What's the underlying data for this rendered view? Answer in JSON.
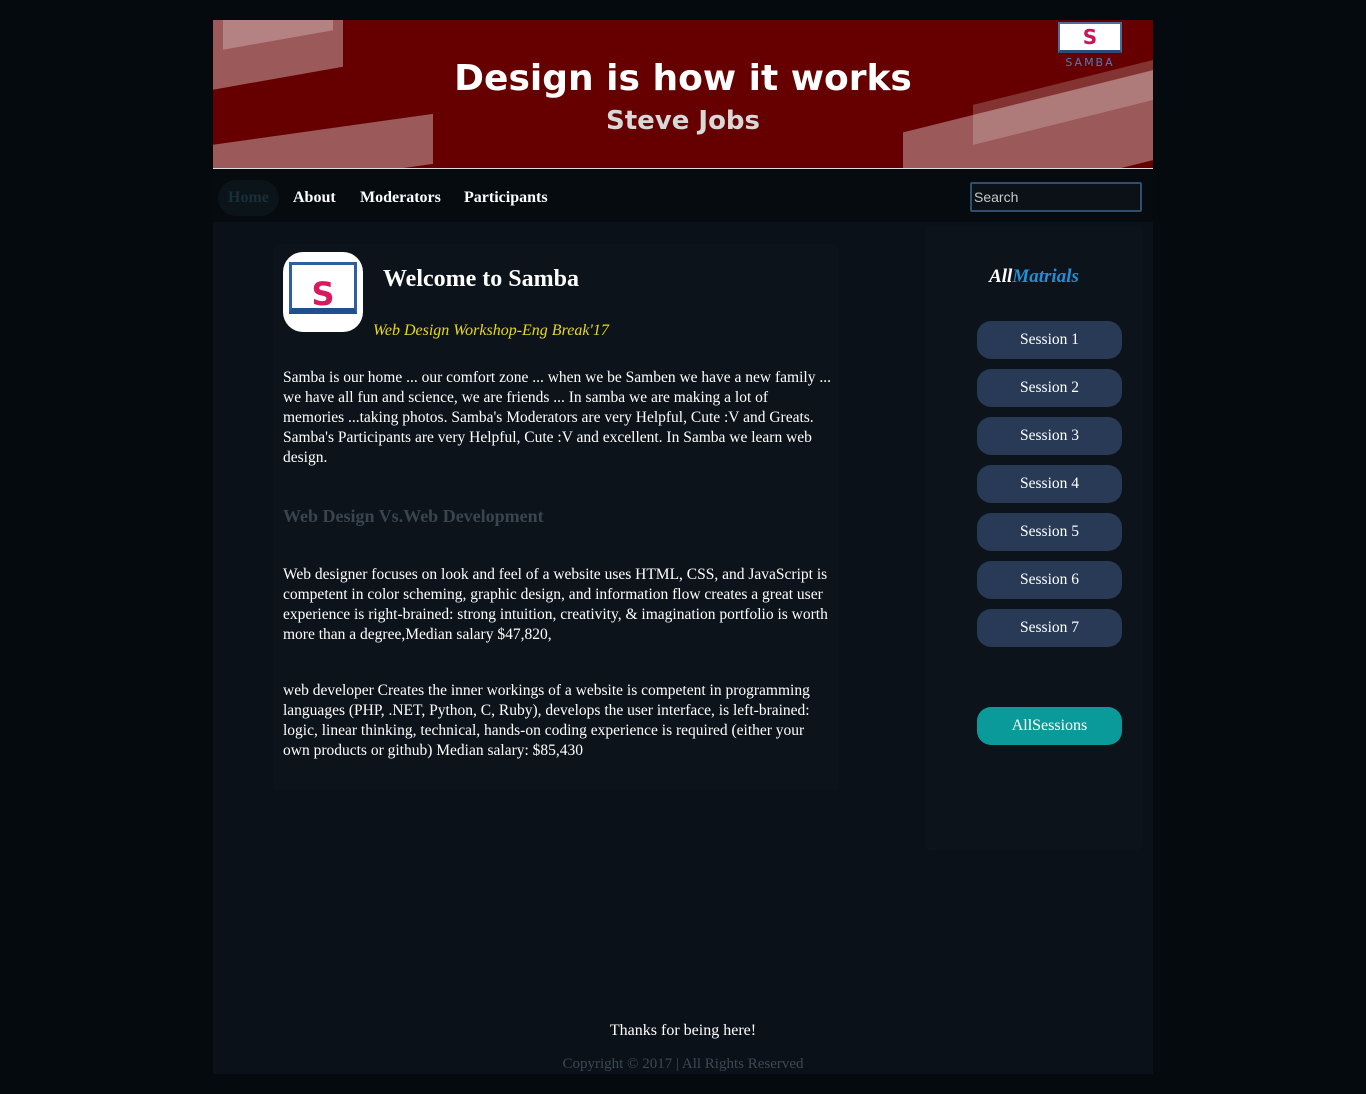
{
  "banner": {
    "title": "Design is how it works",
    "subtitle": "Steve Jobs",
    "logo_text": "SAMBA",
    "logo_letter": "S"
  },
  "nav": {
    "items": [
      {
        "label": "Home",
        "active": true
      },
      {
        "label": "About"
      },
      {
        "label": "Moderators"
      },
      {
        "label": "Participants"
      }
    ],
    "search_placeholder": "Search"
  },
  "main": {
    "logo_letter": "S",
    "title": "Welcome to Samba",
    "tagline": "Web Design Workshop-Eng Break'17",
    "intro": "Samba is our home ... our comfort zone ... when we be Samben we have a new family ... we have all fun and science, we are friends ... In samba we are making a lot of memories ...taking photos. Samba's Moderators are very Helpful, Cute :V and Greats. Samba's Participants are very Helpful, Cute :V and excellent. In Samba we learn web design.",
    "subheading": "Web Design Vs.Web Development",
    "designer_text": "Web designer focuses on look and feel of a website uses HTML, CSS, and JavaScript is competent in color scheming, graphic design, and information flow creates a great user experience is right-brained: strong intuition, creativity, & imagination portfolio is worth more than a degree,Median salary $47,820,",
    "developer_text": "web developer Creates the inner workings of a website is competent in programming languages (PHP, .NET, Python, C, Ruby), develops the user interface, is left-brained: logic, linear thinking, technical, hands-on coding experience is required (either your own products or github) Median salary: $85,430"
  },
  "sidebar": {
    "title_part1": "All",
    "title_part2": "Matrials",
    "sessions": [
      "Session 1",
      "Session 2",
      "Session 3",
      "Session 4",
      "Session 5",
      "Session 6",
      "Session 7"
    ],
    "all_sessions_label": "AllSessions"
  },
  "footer": {
    "thanks": "Thanks for being here!",
    "copyright": "Copyright © 2017 | All Rights Reserved"
  },
  "colors": {
    "banner_bg": "#660000",
    "tagline": "#e8d820",
    "session_button": "#283a56",
    "all_sessions_button": "#0a9a9a",
    "sidebar_title_accent": "#1e90d8"
  }
}
